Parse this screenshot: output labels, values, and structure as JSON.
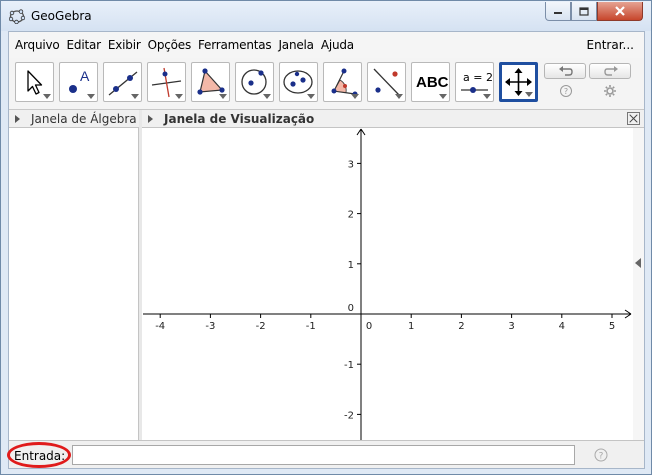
{
  "window": {
    "title": "GeoGebra",
    "controls": [
      "minimize-icon",
      "maximize-icon",
      "close-icon"
    ]
  },
  "menubar": {
    "items": [
      "Arquivo",
      "Editar",
      "Exibir",
      "Opções",
      "Ferramentas",
      "Janela",
      "Ajuda"
    ],
    "signin": "Entrar..."
  },
  "toolbar": {
    "tools": [
      {
        "name": "move-tool-icon"
      },
      {
        "name": "point-tool-icon",
        "label": "A"
      },
      {
        "name": "line-tool-icon"
      },
      {
        "name": "perpendicular-line-tool-icon"
      },
      {
        "name": "polygon-tool-icon"
      },
      {
        "name": "circle-tool-icon"
      },
      {
        "name": "ellipse-tool-icon"
      },
      {
        "name": "angle-tool-icon"
      },
      {
        "name": "reflect-tool-icon"
      },
      {
        "name": "text-tool-icon",
        "label": "ABC"
      },
      {
        "name": "slider-tool-icon",
        "label": "a = 2"
      },
      {
        "name": "move-graphics-view-tool-icon"
      }
    ],
    "undo_icon": "undo-icon",
    "redo_icon": "redo-icon",
    "help_icon": "help-icon",
    "settings_icon": "gear-icon"
  },
  "panels": {
    "algebra_title": "Janela de Álgebra",
    "graphics_title": "Janela de Visualização"
  },
  "graphics": {
    "x_ticks": [
      "-4",
      "-3",
      "-2",
      "-1",
      "0",
      "1",
      "2",
      "3",
      "4",
      "5"
    ],
    "y_ticks_pos": [
      "3",
      "2",
      "1",
      "0"
    ],
    "y_ticks_neg": [
      "-1",
      "-2"
    ]
  },
  "inputbar": {
    "label": "Entrada:",
    "value": "",
    "placeholder": ""
  },
  "annotation": {
    "color": "#e01b1b",
    "shape": "ellipse around input label"
  }
}
